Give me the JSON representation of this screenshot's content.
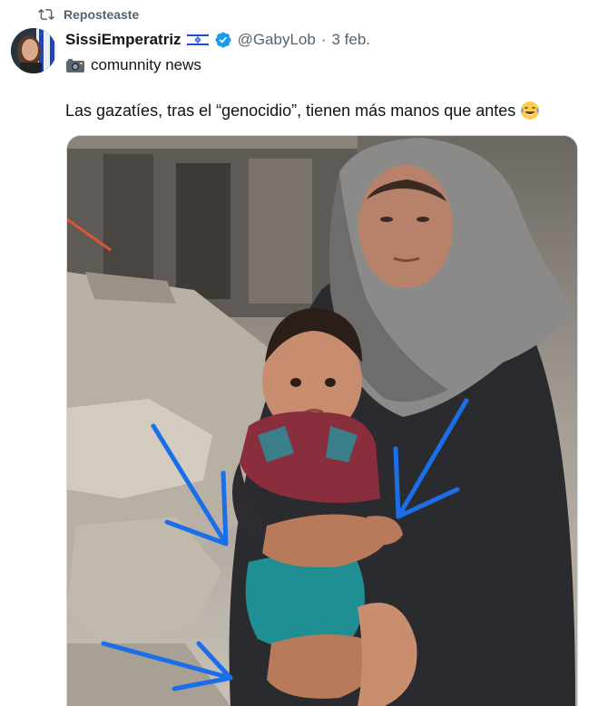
{
  "repost": {
    "label": "Reposteaste",
    "icon": "repost-icon"
  },
  "author": {
    "display_name": "SissiEmperatriz",
    "handle": "@GabyLob",
    "separator": "·",
    "date": "3 feb.",
    "flag_icon": "israel-flag-icon",
    "verified_icon": "verified-badge-icon",
    "verified_color": "#1d9bf0"
  },
  "bio": {
    "icon": "camera-icon",
    "text": "comunnity news"
  },
  "tweet": {
    "text": "Las gazatíes, tras el “genocidio”, tienen más manos que antes",
    "emoji": "face-with-tears-of-joy-icon"
  },
  "media": {
    "alt": "Foto de una mujer con hiyab sosteniendo a un niño entre escombros, con flechas azules señalando las manos",
    "arrow_color": "#1a6fe8",
    "line_color": "#e0523a"
  }
}
